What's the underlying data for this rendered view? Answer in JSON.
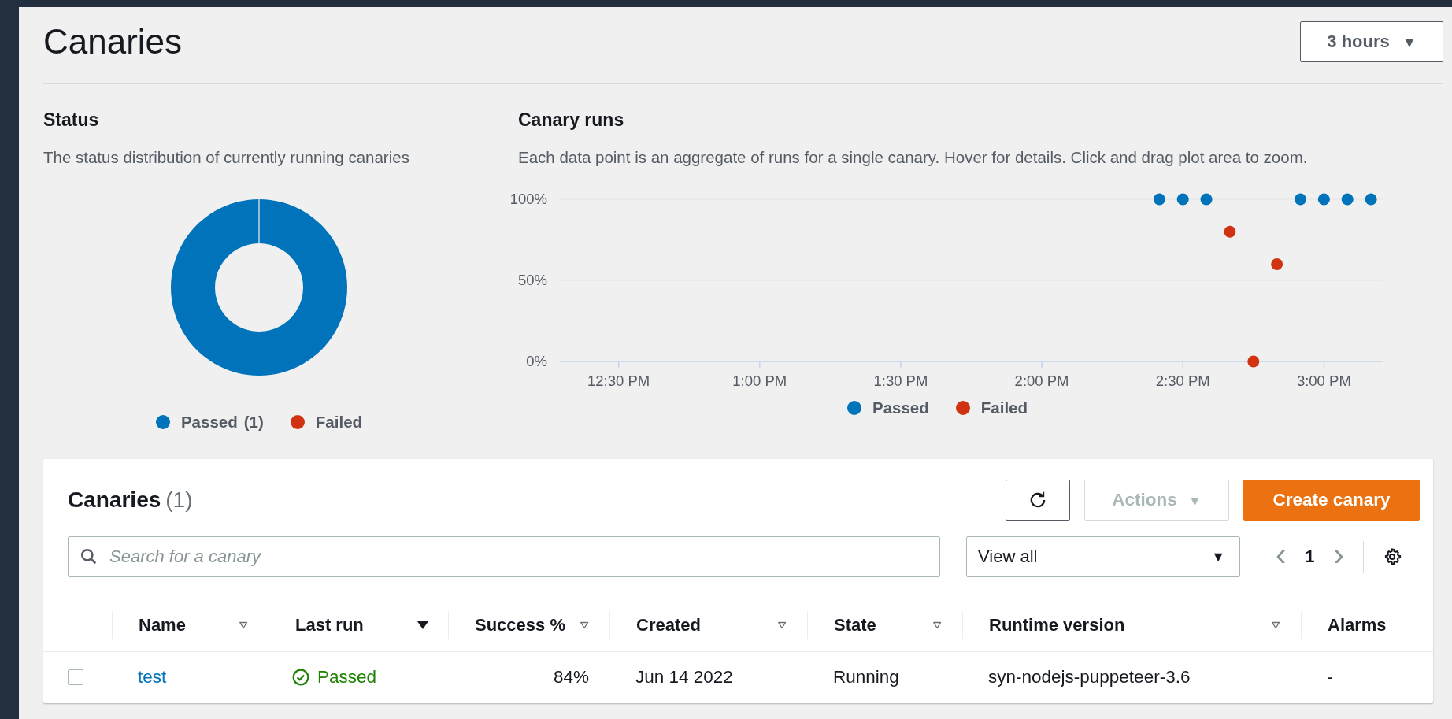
{
  "page_title": "Canaries",
  "time_range": {
    "label": "3 hours",
    "caret": "▼"
  },
  "status_panel": {
    "title": "Status",
    "description": "The status distribution of currently running canaries",
    "legend": [
      {
        "label": "Passed",
        "count": "(1)",
        "color": "#0073bb"
      },
      {
        "label": "Failed",
        "color": "#d13212"
      }
    ]
  },
  "runs_panel": {
    "title": "Canary runs",
    "description": "Each data point is an aggregate of runs for a single canary. Hover for details. Click and drag plot area to zoom.",
    "chart_data": {
      "type": "scatter",
      "legend": "bottom",
      "categories": [
        null,
        null,
        "12:30 PM",
        null,
        null,
        null,
        null,
        null,
        "1:00 PM",
        null,
        null,
        null,
        null,
        null,
        "1:30 PM",
        null,
        null,
        null,
        null,
        null,
        "2:00 PM",
        null,
        null,
        null,
        null,
        null,
        "2:30 PM",
        null,
        null,
        null,
        null,
        null,
        "3:00 PM",
        null,
        null
      ],
      "ylim": [
        0,
        100
      ],
      "yticks": [
        {
          "value": 0,
          "label": "0%"
        },
        {
          "value": 50,
          "label": "50%"
        },
        {
          "value": 100,
          "label": "100%"
        }
      ],
      "series": [
        {
          "name": "Passed",
          "color": "#0073bb",
          "values": [
            null,
            null,
            null,
            null,
            null,
            null,
            null,
            null,
            null,
            null,
            null,
            null,
            null,
            null,
            null,
            null,
            null,
            null,
            null,
            null,
            null,
            null,
            null,
            null,
            null,
            100,
            100,
            100,
            null,
            null,
            null,
            100,
            100,
            100,
            100
          ]
        },
        {
          "name": "Failed",
          "color": "#d13212",
          "values": [
            null,
            null,
            null,
            null,
            null,
            null,
            null,
            null,
            null,
            null,
            null,
            null,
            null,
            null,
            null,
            null,
            null,
            null,
            null,
            null,
            null,
            null,
            null,
            null,
            null,
            null,
            null,
            null,
            80,
            0,
            60,
            null,
            null,
            null,
            null
          ]
        }
      ]
    }
  },
  "table": {
    "title": "Canaries",
    "count": "(1)",
    "actions": {
      "label": "Actions",
      "caret": "▼",
      "disabled": true
    },
    "create_button": "Create canary",
    "search": {
      "placeholder": "Search for a canary"
    },
    "filter": {
      "value": "View all",
      "caret": "▼"
    },
    "pagination": {
      "prev": "‹",
      "page": "1",
      "next": "›"
    },
    "columns": [
      {
        "label": "Name",
        "sorted": false,
        "sortable": true
      },
      {
        "label": "Last run",
        "sorted": true,
        "sortable": true
      },
      {
        "label": "Success %",
        "sorted": false,
        "sortable": true
      },
      {
        "label": "Created",
        "sorted": false,
        "sortable": true
      },
      {
        "label": "State",
        "sorted": false,
        "sortable": true
      },
      {
        "label": "Runtime version",
        "sorted": false,
        "sortable": true
      },
      {
        "label": "Alarms",
        "sortable": false
      }
    ],
    "rows": [
      {
        "checked": false,
        "name": "test",
        "last_run": "Passed",
        "success": "84%",
        "created": "Jun 14 2022",
        "state": "Running",
        "runtime": "syn-nodejs-puppeteer-3.6",
        "alarms": "-"
      }
    ]
  }
}
